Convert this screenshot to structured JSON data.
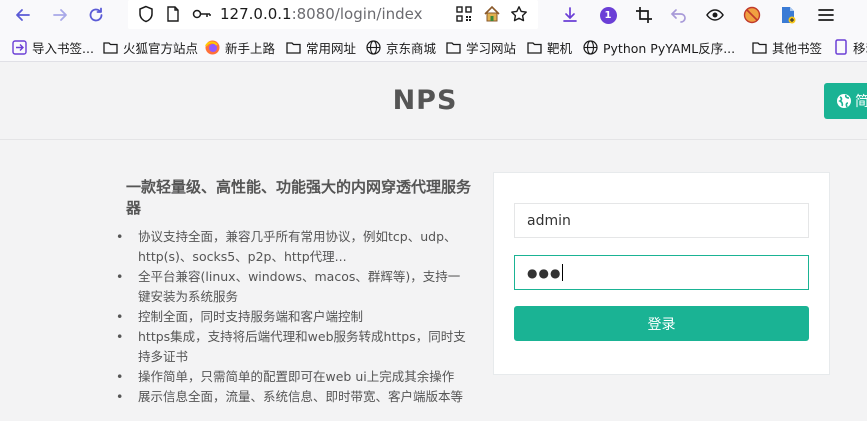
{
  "browser": {
    "url_host": "127.0.0.1",
    "url_rest": ":8080/login/index",
    "extension_badge": "1"
  },
  "bookmarks": [
    {
      "label": "导入书签...",
      "icon": "import-icon"
    },
    {
      "label": "火狐官方站点",
      "icon": "folder-icon"
    },
    {
      "label": "新手上路",
      "icon": "firefox-icon"
    },
    {
      "label": "常用网址",
      "icon": "folder-icon"
    },
    {
      "label": "京东商城",
      "icon": "globe-icon"
    },
    {
      "label": "学习网站",
      "icon": "folder-icon"
    },
    {
      "label": "靶机",
      "icon": "folder-icon"
    },
    {
      "label": "Python PyYAML反序...",
      "icon": "globe-icon"
    },
    {
      "label": "其他书签",
      "icon": "folder-icon"
    },
    {
      "label": "移动",
      "icon": "mobile-icon"
    }
  ],
  "header": {
    "brand": "NPS",
    "lang_button": "简"
  },
  "intro": {
    "title": "一款轻量级、高性能、功能强大的内网穿透代理服务器",
    "features": [
      "协议支持全面，兼容几乎所有常用协议，例如tcp、udp、http(s)、socks5、p2p、http代理...",
      "全平台兼容(linux、windows、macos、群辉等)，支持一键安装为系统服务",
      "控制全面，同时支持服务端和客户端控制",
      "https集成，支持将后端代理和web服务转成https，同时支持多证书",
      "操作简单，只需简单的配置即可在web ui上完成其余操作",
      "展示信息全面，流量、系统信息、即时带宽、客户端版本等"
    ]
  },
  "login": {
    "username_value": "admin",
    "password_mask": "●●●",
    "submit_label": "登录"
  },
  "colors": {
    "accent": "#1ab394",
    "badge": "#6b3fd6"
  }
}
